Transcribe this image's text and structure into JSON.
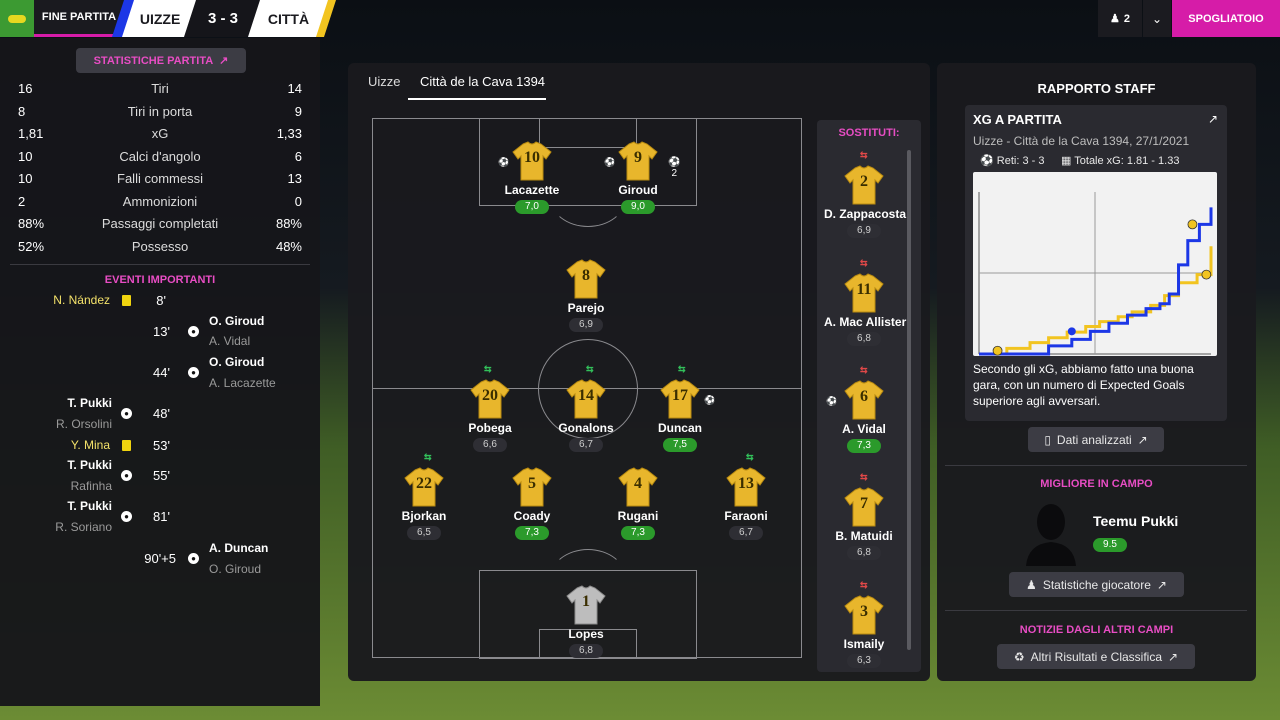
{
  "header": {
    "phase": "FINE PARTITA",
    "home_team": "UIZZE",
    "score": "3 - 3",
    "away_team": "CITTÀ",
    "users_count": "2",
    "dressing_room": "SPOGLIATOIO",
    "colors": {
      "accent": "#d61ca8",
      "home_stripe": "#1c37e6",
      "away_stripe": "#f2c420"
    }
  },
  "match_stats": {
    "button_label": "STATISTICHE PARTITA",
    "rows": [
      {
        "label": "Tiri",
        "home": "16",
        "away": "14"
      },
      {
        "label": "Tiri in porta",
        "home": "8",
        "away": "9"
      },
      {
        "label": "xG",
        "home": "1,81",
        "away": "1,33"
      },
      {
        "label": "Calci d'angolo",
        "home": "10",
        "away": "6"
      },
      {
        "label": "Falli commessi",
        "home": "10",
        "away": "13"
      },
      {
        "label": "Ammonizioni",
        "home": "2",
        "away": "0"
      },
      {
        "label": "Passaggi completati",
        "home": "88%",
        "away": "88%"
      },
      {
        "label": "Possesso",
        "home": "52%",
        "away": "48%"
      }
    ]
  },
  "events": {
    "title": "EVENTI IMPORTANTI",
    "items": [
      {
        "side": "home",
        "type": "yellow",
        "minute": "8'",
        "name": "N. Nández",
        "sub": ""
      },
      {
        "side": "away",
        "type": "goal",
        "minute": "13'",
        "name": "O. Giroud",
        "sub": "A. Vidal"
      },
      {
        "side": "away",
        "type": "goal",
        "minute": "44'",
        "name": "O. Giroud",
        "sub": "A. Lacazette"
      },
      {
        "side": "home",
        "type": "goal",
        "minute": "48'",
        "name": "T. Pukki",
        "sub": "R. Orsolini"
      },
      {
        "side": "home",
        "type": "yellow",
        "minute": "53'",
        "name": "Y. Mina",
        "sub": ""
      },
      {
        "side": "home",
        "type": "goal",
        "minute": "55'",
        "name": "T. Pukki",
        "sub": "Rafinha"
      },
      {
        "side": "home",
        "type": "goal",
        "minute": "81'",
        "name": "T. Pukki",
        "sub": "R. Soriano"
      },
      {
        "side": "away",
        "type": "goal",
        "minute": "90'+5",
        "name": "A. Duncan",
        "sub": "O. Giroud"
      }
    ]
  },
  "lineup": {
    "tabs": [
      "Uizze",
      "Città de la Cava 1394"
    ],
    "active_tab": 1,
    "players": [
      {
        "num": "10",
        "name": "Lacazette",
        "rating": "7,0",
        "good": true
      },
      {
        "num": "9",
        "name": "Giroud",
        "rating": "9,0",
        "good": true,
        "goals": "2"
      },
      {
        "num": "8",
        "name": "Parejo",
        "rating": "6,9",
        "good": false
      },
      {
        "num": "20",
        "name": "Pobega",
        "rating": "6,6",
        "good": false
      },
      {
        "num": "14",
        "name": "Gonalons",
        "rating": "6,7",
        "good": false
      },
      {
        "num": "17",
        "name": "Duncan",
        "rating": "7,5",
        "good": true
      },
      {
        "num": "22",
        "name": "Bjorkan",
        "rating": "6,5",
        "good": false
      },
      {
        "num": "5",
        "name": "Coady",
        "rating": "7,3",
        "good": true
      },
      {
        "num": "4",
        "name": "Rugani",
        "rating": "7,3",
        "good": true
      },
      {
        "num": "13",
        "name": "Faraoni",
        "rating": "6,7",
        "good": false
      },
      {
        "num": "1",
        "name": "Lopes",
        "rating": "6,8",
        "good": false
      }
    ],
    "subs_title": "SOSTITUTI:",
    "subs": [
      {
        "num": "2",
        "name": "D. Zappacosta",
        "rating": "6,9",
        "good": false
      },
      {
        "num": "11",
        "name": "A. Mac Allister",
        "rating": "6,8",
        "good": false
      },
      {
        "num": "6",
        "name": "A. Vidal",
        "rating": "7,3",
        "good": true
      },
      {
        "num": "7",
        "name": "B. Matuidi",
        "rating": "6,8",
        "good": false
      },
      {
        "num": "3",
        "name": "Ismaily",
        "rating": "6,3",
        "good": false
      }
    ]
  },
  "staff_report": {
    "title": "RAPPORTO STAFF",
    "xg_title": "XG A PARTITA",
    "match_info": "Uizze - Città de la Cava 1394, 27/1/2021",
    "goals_label": "Reti: 3 - 3",
    "total_xg_label": "Totale xG: 1.81 - 1.33",
    "comment": "Secondo gli xG, abbiamo fatto una buona gara, con un numero di Expected Goals superiore agli avversari.",
    "analyze_button": "Dati analizzati",
    "best_title": "MIGLIORE IN CAMPO",
    "best_player": "Teemu Pukki",
    "best_rating": "9.5",
    "player_stats_button": "Statistiche giocatore",
    "news_title": "NOTIZIE DAGLI ALTRI CAMPI",
    "news_button": "Altri Risultati e Classifica"
  },
  "chart_data": {
    "type": "line",
    "series": [
      {
        "color": "#f2c420",
        "steps": [
          [
            0.0,
            0.0
          ],
          [
            0.12,
            0.07
          ],
          [
            0.22,
            0.14
          ],
          [
            0.3,
            0.2
          ],
          [
            0.38,
            0.27
          ],
          [
            0.46,
            0.34
          ],
          [
            0.52,
            0.4
          ],
          [
            0.6,
            0.46
          ],
          [
            0.66,
            0.52
          ],
          [
            0.74,
            0.6
          ],
          [
            0.8,
            0.72
          ],
          [
            0.86,
            0.88
          ],
          [
            0.94,
            0.98
          ],
          [
            1.0,
            1.33
          ]
        ]
      },
      {
        "color": "#1c37e6",
        "steps": [
          [
            0.0,
            0.0
          ],
          [
            0.3,
            0.1
          ],
          [
            0.4,
            0.18
          ],
          [
            0.48,
            0.28
          ],
          [
            0.56,
            0.38
          ],
          [
            0.64,
            0.48
          ],
          [
            0.72,
            0.56
          ],
          [
            0.78,
            0.62
          ],
          [
            0.82,
            0.74
          ],
          [
            0.86,
            1.1
          ],
          [
            0.9,
            1.4
          ],
          [
            0.95,
            1.6
          ],
          [
            1.0,
            1.81
          ]
        ]
      }
    ],
    "goals": [
      {
        "team": "home",
        "x": 0.4,
        "y": 0.28
      },
      {
        "team": "away",
        "x": 0.08,
        "y": 0.04
      },
      {
        "team": "away",
        "x": 0.92,
        "y": 1.6
      },
      {
        "team": "away",
        "x": 0.98,
        "y": 0.98
      }
    ],
    "xlim": [
      0,
      1
    ],
    "ylim": [
      0,
      2.0
    ]
  }
}
